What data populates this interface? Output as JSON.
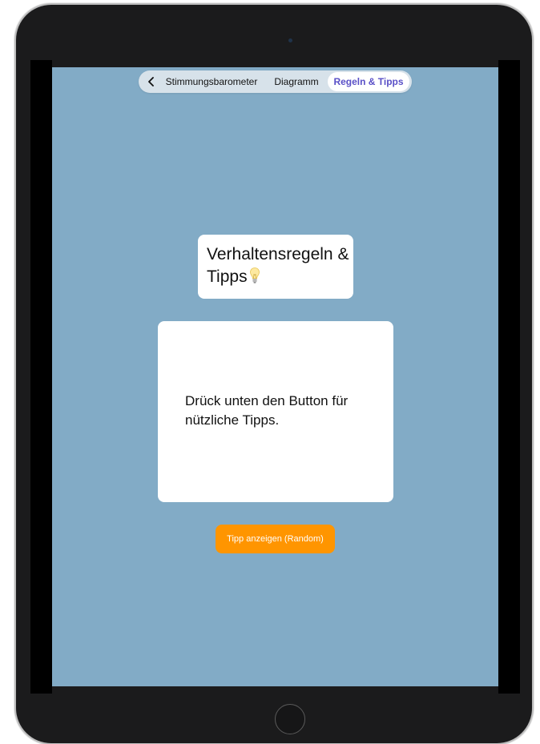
{
  "nav": {
    "back_icon": "chevron-left-icon",
    "tabs": [
      {
        "label": "Stimmungsbarometer"
      },
      {
        "label": "Diagramm"
      },
      {
        "label": "Regeln & Tipps",
        "selected": true
      }
    ]
  },
  "title_card": {
    "title": "Verhaltensregeln & Tipps",
    "icon": "lightbulb-icon"
  },
  "tip_card": {
    "text": "Drück unten den Button für nützliche Tipps."
  },
  "tip_button": {
    "label": "Tipp anzeigen (Random)"
  },
  "colors": {
    "background": "#82abc6",
    "accent_button": "#ff9500",
    "selected_tab_text": "#5a50c7"
  }
}
